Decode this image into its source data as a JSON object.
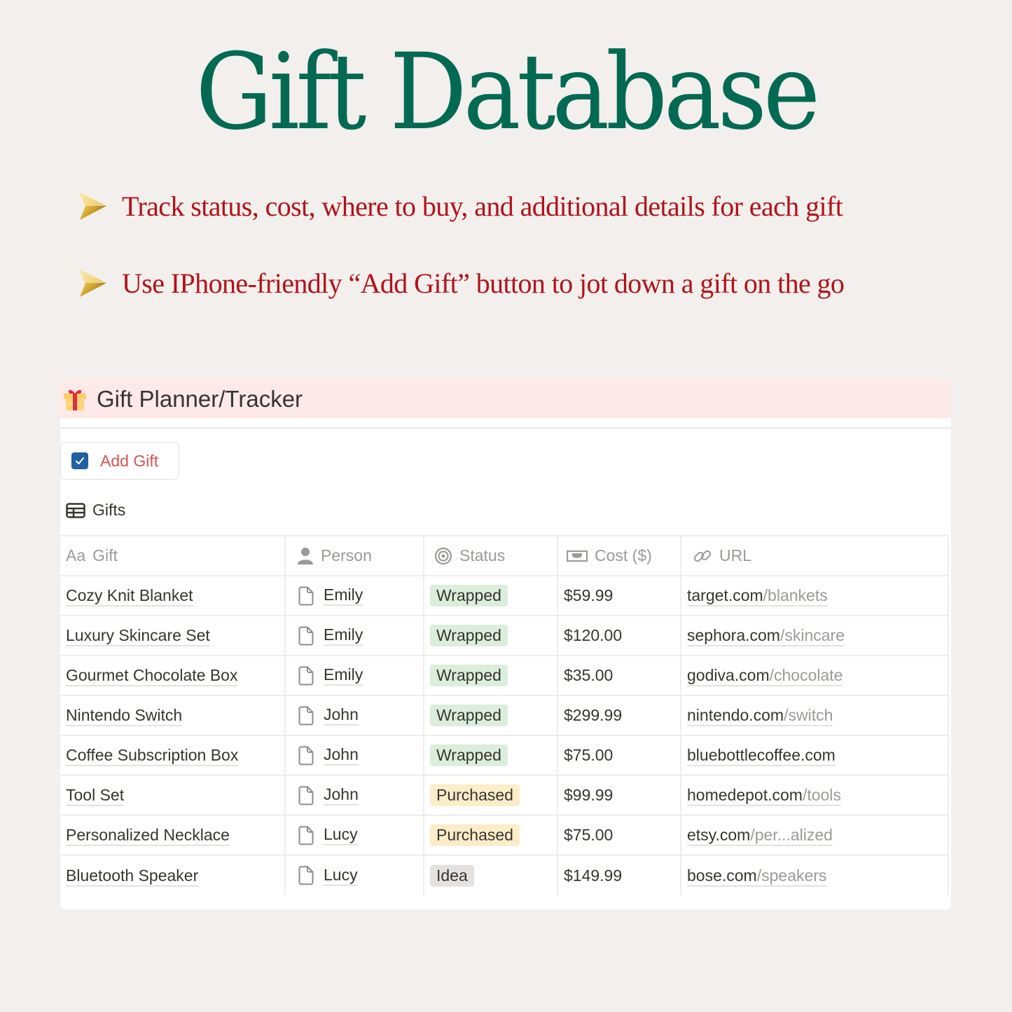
{
  "hero": {
    "title": "Gift Database",
    "title_color": "#026a52",
    "bullets": [
      {
        "icon": "gold-arrow-icon",
        "text": "Track status, cost, where to buy, and additional details for each gift"
      },
      {
        "icon": "gold-arrow-icon",
        "text": "Use IPhone-friendly “Add Gift” button to jot down a gift on the go"
      }
    ],
    "bullet_color": "#b3121a"
  },
  "panel": {
    "icon": "gift-icon",
    "title": "Gift Planner/Tracker",
    "add_button": {
      "icon": "checkbox-icon",
      "label": "Add Gift"
    },
    "view": {
      "icon": "table-icon",
      "label": "Gifts"
    }
  },
  "table": {
    "columns": [
      {
        "key": "gift",
        "icon_text": "Aa",
        "label": "Gift"
      },
      {
        "key": "person",
        "icon": "person-icon",
        "label": "Person"
      },
      {
        "key": "status",
        "icon": "target-icon",
        "label": "Status"
      },
      {
        "key": "cost",
        "icon": "money-icon",
        "label": "Cost ($)"
      },
      {
        "key": "url",
        "icon": "link-icon",
        "label": "URL"
      }
    ],
    "status_colors": {
      "Wrapped": "#dbeddb",
      "Purchased": "#fdecc8",
      "Idea": "#e3e2e0"
    },
    "rows": [
      {
        "gift": "Cozy Knit Blanket",
        "person": "Emily",
        "status": "Wrapped",
        "cost": "$59.99",
        "url_domain": "target.com",
        "url_path": "/blankets"
      },
      {
        "gift": "Luxury Skincare Set",
        "person": "Emily",
        "status": "Wrapped",
        "cost": "$120.00",
        "url_domain": "sephora.com",
        "url_path": "/skincare"
      },
      {
        "gift": "Gourmet Chocolate Box",
        "person": "Emily",
        "status": "Wrapped",
        "cost": "$35.00",
        "url_domain": "godiva.com",
        "url_path": "/chocolate"
      },
      {
        "gift": "Nintendo Switch",
        "person": "John",
        "status": "Wrapped",
        "cost": "$299.99",
        "url_domain": "nintendo.com",
        "url_path": "/switch"
      },
      {
        "gift": "Coffee Subscription Box",
        "person": "John",
        "status": "Wrapped",
        "cost": "$75.00",
        "url_domain": "bluebottlecoffee.com",
        "url_path": ""
      },
      {
        "gift": "Tool Set",
        "person": "John",
        "status": "Purchased",
        "cost": "$99.99",
        "url_domain": "homedepot.com",
        "url_path": "/tools"
      },
      {
        "gift": "Personalized Necklace",
        "person": "Lucy",
        "status": "Purchased",
        "cost": "$75.00",
        "url_domain": "etsy.com",
        "url_path": "/per...alized"
      },
      {
        "gift": "Bluetooth Speaker",
        "person": "Lucy",
        "status": "Idea",
        "cost": "$149.99",
        "url_domain": "bose.com",
        "url_path": "/speakers"
      }
    ]
  }
}
